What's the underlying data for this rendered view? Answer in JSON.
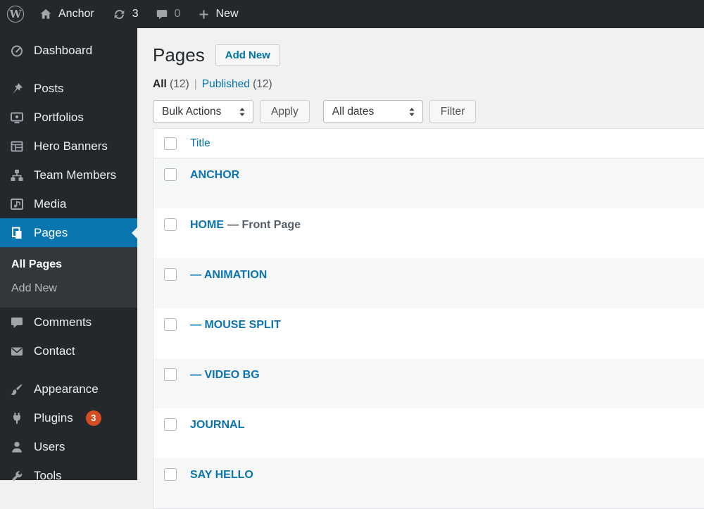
{
  "admin_bar": {
    "site_name": "Anchor",
    "updates_count": "3",
    "comments_count": "0",
    "new_label": "New"
  },
  "sidebar": {
    "items": [
      {
        "label": "Dashboard"
      },
      {
        "label": "Posts"
      },
      {
        "label": "Portfolios"
      },
      {
        "label": "Hero Banners"
      },
      {
        "label": "Team Members"
      },
      {
        "label": "Media"
      },
      {
        "label": "Pages",
        "active": true
      },
      {
        "label": "Comments"
      },
      {
        "label": "Contact"
      },
      {
        "label": "Appearance"
      },
      {
        "label": "Plugins",
        "badge": "3"
      },
      {
        "label": "Users"
      },
      {
        "label": "Tools"
      }
    ],
    "pages_submenu": [
      {
        "label": "All Pages",
        "active": true
      },
      {
        "label": "Add New"
      }
    ]
  },
  "main": {
    "page_title": "Pages",
    "add_new_button": "Add New",
    "views": {
      "all_label": "All",
      "all_count": "(12)",
      "separator": "|",
      "published_label": "Published",
      "published_count": "(12)"
    },
    "toolbar": {
      "bulk_actions_value": "Bulk Actions",
      "apply_button": "Apply",
      "dates_value": "All dates",
      "filter_button": "Filter"
    },
    "table": {
      "title_header": "Title",
      "rows": [
        {
          "title": "ANCHOR"
        },
        {
          "title": "HOME",
          "state": "— Front Page"
        },
        {
          "title": "— ANIMATION"
        },
        {
          "title": "— MOUSE SPLIT"
        },
        {
          "title": "— VIDEO BG"
        },
        {
          "title": "JOURNAL"
        },
        {
          "title": "SAY HELLO"
        }
      ]
    }
  },
  "colors": {
    "admin_bar_bg": "#23282d",
    "submenu_bg": "#32373c",
    "active_menu_blue": "#0a76b0",
    "link_blue": "#0073aa",
    "content_bg": "#f1f1f1",
    "alt_row_bg": "#f6f7f7",
    "plugins_badge": "#d54e21"
  }
}
